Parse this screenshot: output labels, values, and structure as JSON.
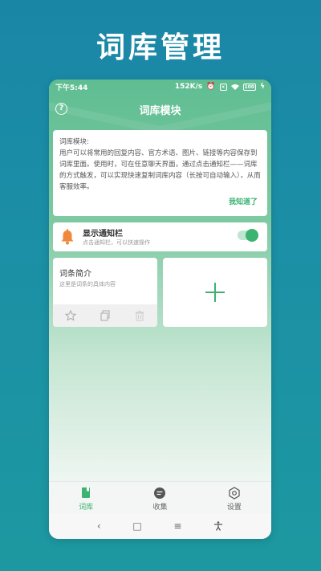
{
  "promo": {
    "title": "词库管理"
  },
  "status_bar": {
    "time": "下午5:44",
    "network_speed": "152K/s",
    "battery": "100",
    "icons": [
      "alarm-icon",
      "sim-icon",
      "wifi-icon",
      "battery-icon",
      "charging-icon"
    ]
  },
  "header": {
    "title": "词库模块",
    "help_icon": "help-icon"
  },
  "info_card": {
    "title": "词库模块:",
    "body": "用户可以将常用的回复内容、官方术语、图片、链接等内容保存到词库里面。使用时，可在任意聊天界面，通过点击通知栏——词库的方式触发，可以实现快速复制词库内容（长按可自动输入），从而客服效率。",
    "ok_button": "我知道了"
  },
  "notify_card": {
    "title": "显示通知栏",
    "subtitle": "点击通知栏，可以快速操作",
    "toggle_on": true,
    "icon": "bell-icon"
  },
  "entry_card": {
    "title": "词条简介",
    "subtitle": "这里是词条的具体内容",
    "actions": [
      "star-icon",
      "copy-icon",
      "trash-icon"
    ]
  },
  "add_card": {
    "icon": "plus-icon"
  },
  "tabs": [
    {
      "label": "词库",
      "icon": "book-icon",
      "active": true
    },
    {
      "label": "收集",
      "icon": "chat-icon",
      "active": false
    },
    {
      "label": "设置",
      "icon": "settings-icon",
      "active": false
    }
  ],
  "nav": {
    "back": "‹",
    "home": "□",
    "menu": "≡",
    "accessibility": "accessibility-icon"
  },
  "colors": {
    "accent": "#3cb371",
    "bell": "#f0883c",
    "background": "#1b8fa6"
  }
}
